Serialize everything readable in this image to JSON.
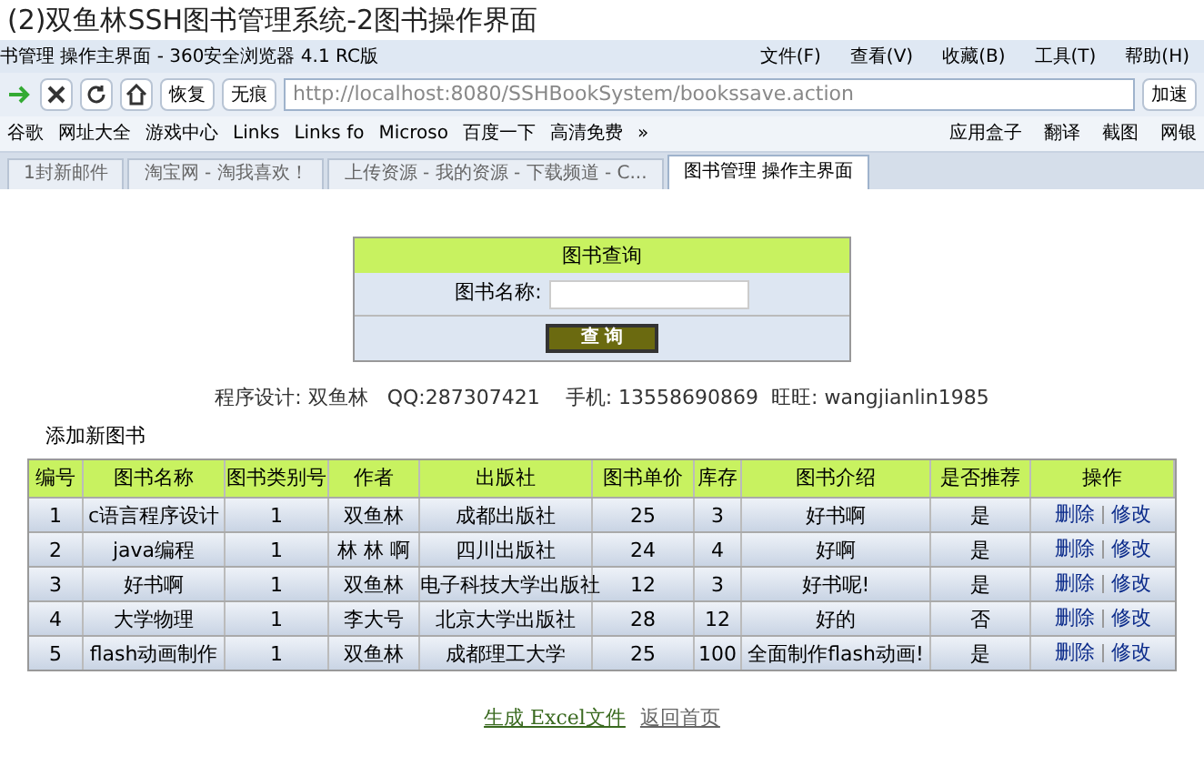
{
  "caption": "(2)双鱼林SSH图书管理系统-2图书操作界面",
  "browser": {
    "title": "书管理 操作主界面 - 360安全浏览器 4.1 RC版",
    "menu": [
      "文件(F)",
      "查看(V)",
      "收藏(B)",
      "工具(T)",
      "帮助(H)"
    ],
    "restore": "恢复",
    "incognito": "无痕",
    "url_host": "http://localhost",
    "url_rest": ":8080/SSHBookSystem/bookssave.action",
    "speedup": "加速",
    "bookmarks": [
      "谷歌",
      "网址大全",
      "游戏中心",
      "Links",
      "Links fo",
      "Microso",
      "百度一下",
      "高清免费",
      "»"
    ],
    "bookmarks_right": [
      "应用盒子",
      "翻译",
      "截图",
      "网银"
    ],
    "tabs": [
      {
        "label": "1封新邮件",
        "selected": false
      },
      {
        "label": "淘宝网 - 淘我喜欢！",
        "selected": false
      },
      {
        "label": "上传资源 - 我的资源 - 下载频道 - C...",
        "selected": false
      },
      {
        "label": "图书管理 操作主界面",
        "selected": true
      }
    ]
  },
  "search": {
    "title": "图书查询",
    "label": "图书名称:",
    "button": "查 询"
  },
  "credits": "程序设计: 双鱼林   QQ:287307421    手机: 13558690869  旺旺: wangjianlin1985",
  "add_link": "添加新图书",
  "table": {
    "columns": [
      "编号",
      "图书名称",
      "图书类别号",
      "作者",
      "出版社",
      "图书单价",
      "库存",
      "图书介绍",
      "是否推荐",
      "操作"
    ],
    "rows": [
      {
        "cells": [
          "1",
          "c语言程序设计",
          "1",
          "双鱼林",
          "成都出版社",
          "25",
          "3",
          "好书啊",
          "是"
        ],
        "actions": [
          "删除",
          "修改"
        ]
      },
      {
        "cells": [
          "2",
          "java编程",
          "1",
          "林 林 啊",
          "四川出版社",
          "24",
          "4",
          "好啊",
          "是"
        ],
        "actions": [
          "删除",
          "修改"
        ]
      },
      {
        "cells": [
          "3",
          "好书啊",
          "1",
          "双鱼林",
          "电子科技大学出版社",
          "12",
          "3",
          "好书呢!",
          "是"
        ],
        "actions": [
          "删除",
          "修改"
        ]
      },
      {
        "cells": [
          "4",
          "大学物理",
          "1",
          "李大号",
          "北京大学出版社",
          "28",
          "12",
          "好的",
          "否"
        ],
        "actions": [
          "删除",
          "修改"
        ]
      },
      {
        "cells": [
          "5",
          "flash动画制作",
          "1",
          "双鱼林",
          "成都理工大学",
          "25",
          "100",
          "全面制作flash动画!",
          "是"
        ],
        "actions": [
          "删除",
          "修改"
        ]
      }
    ]
  },
  "footer": [
    "生成 Excel文件",
    "返回首页"
  ]
}
